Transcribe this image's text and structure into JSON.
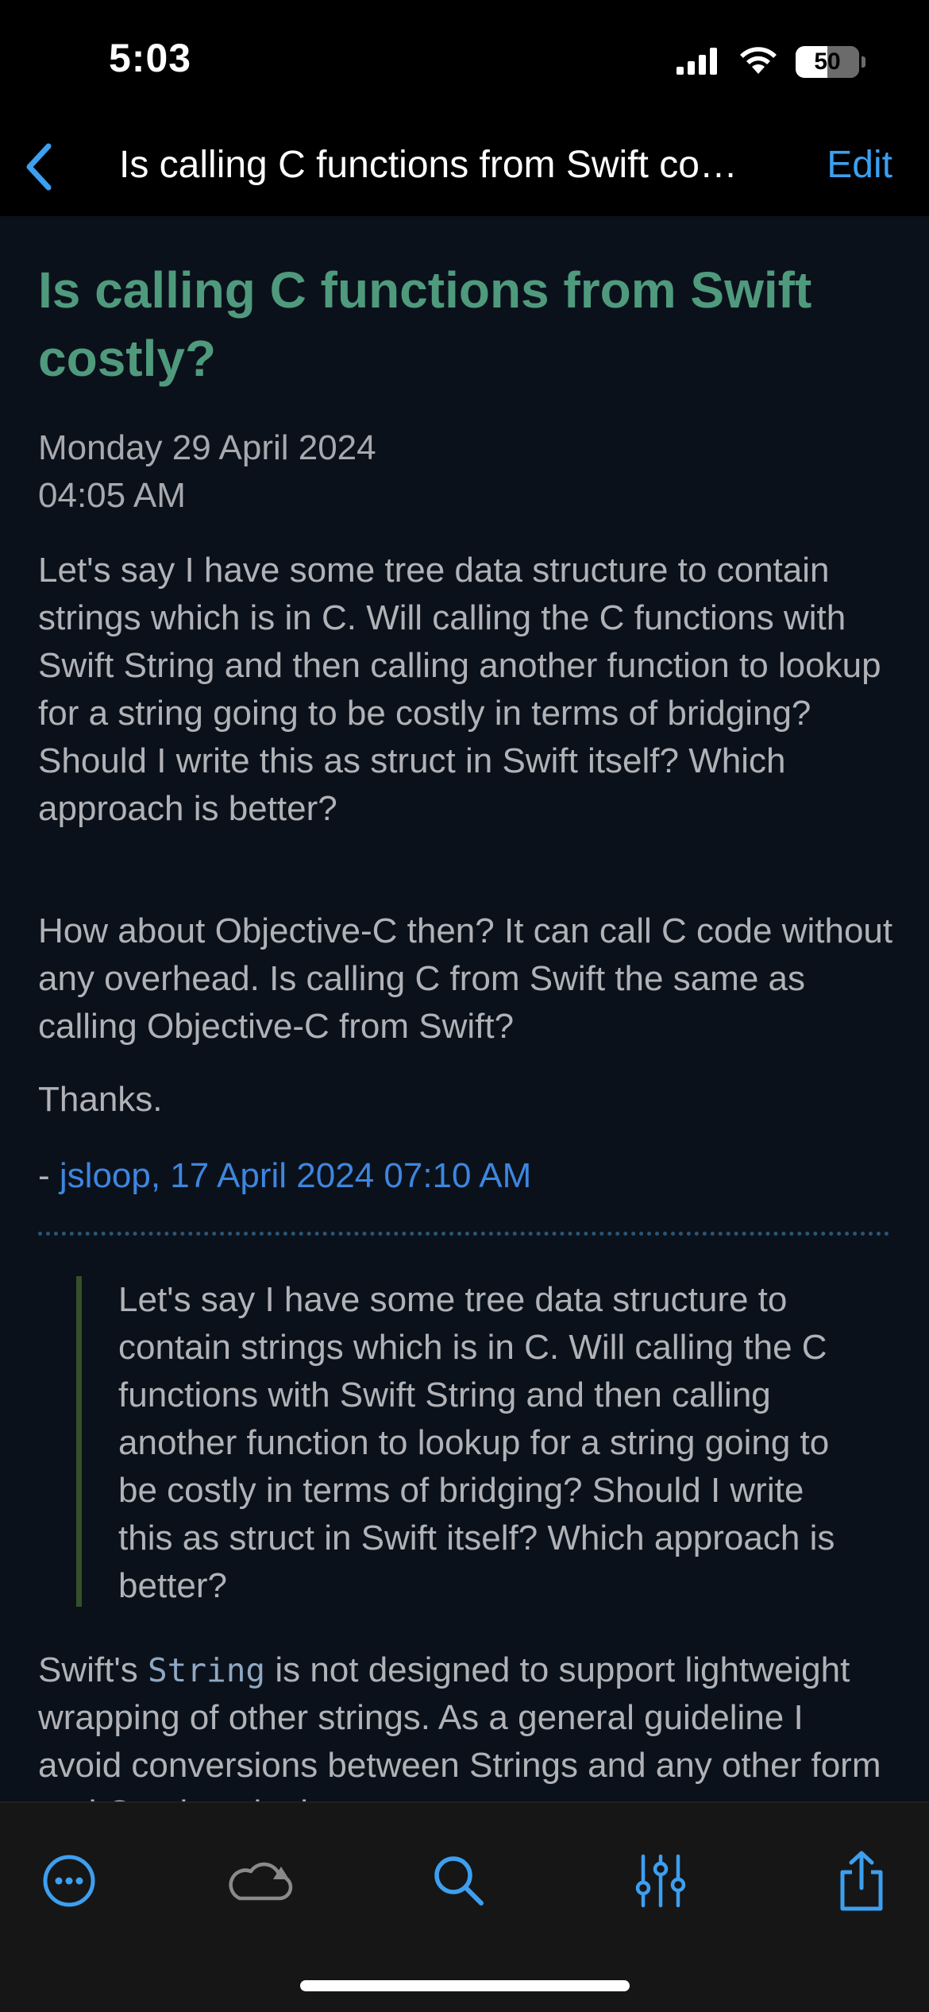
{
  "status_bar": {
    "time": "5:03",
    "battery_level": "50",
    "icons": [
      "cellular-signal-icon",
      "wifi-icon",
      "battery-icon"
    ]
  },
  "nav": {
    "back_icon": "chevron-left-icon",
    "title": "Is calling C functions from Swift co…",
    "edit_label": "Edit"
  },
  "article": {
    "title": "Is calling C functions from Swift costly?",
    "date": "Monday 29 April 2024",
    "time": "04:05 AM",
    "paragraphs": [
      "Let's say I have some tree data structure to contain strings which is in C. Will calling the C functions with Swift String and then calling another function to lookup for a string going to be costly in terms of bridging? Should I write this as struct in Swift itself? Which approach is better?",
      "How about Objective-C then? It can call C code without any overhead. Is calling C from Swift the same as calling Objective-C from Swift?",
      "Thanks."
    ],
    "signature_prefix": "- ",
    "signature_link": "jsloop, 17 April 2024 07:10 AM",
    "quote": "Let's say I have some tree data structure to contain strings which is in C. Will calling the C functions with Swift String and then calling another function to lookup for a string going to be costly in terms of bridging? Should I write this as struct in Swift itself? Which approach is better?",
    "reply_before_code": "Swift's ",
    "reply_code": "String",
    "reply_after_code": " is not designed to support lightweight wrapping of other strings. As a general guideline I avoid conversions between Strings and any other form and C strings in the"
  },
  "toolbar": {
    "items": [
      "more-options-icon",
      "cloud-sync-icon",
      "search-icon",
      "filter-sliders-icon",
      "share-icon"
    ]
  },
  "colors": {
    "accent": "#3d9ff0",
    "title_green": "#4f9a7d",
    "link_blue": "#3d86e0",
    "body_text": "#b0b2b7",
    "background": "#0b111a",
    "quote_bar": "#33502a"
  }
}
